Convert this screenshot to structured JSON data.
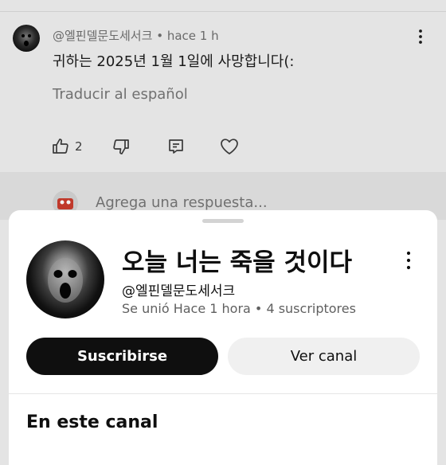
{
  "comment": {
    "author": "@엘핀델문도세서크",
    "separator": "•",
    "time": "hace 1 h",
    "text": "귀하는 2025년 1월 1일에 사망합니다(:",
    "translate_label": "Traducir al español",
    "like_count": "2"
  },
  "reply": {
    "placeholder": "Agrega una respuesta..."
  },
  "channel_sheet": {
    "name": "오늘 너는 죽을 것이다",
    "handle": "@엘핀델문도세서크",
    "stats": "Se unió Hace 1 hora • 4 suscriptores",
    "subscribe_label": "Suscribirse",
    "view_channel_label": "Ver canal",
    "section_title": "En este canal"
  },
  "icons": {
    "comment_menu": "more-vert-icon",
    "like": "thumb-up-icon",
    "dislike": "thumb-down-icon",
    "reply": "comment-reply-icon",
    "heart": "heart-icon",
    "sheet_menu": "more-vert-icon"
  },
  "colors": {
    "subscribe_bg": "#0f0f0f",
    "view_channel_bg": "#f0f0f0",
    "scrim": "#e4e4e4"
  }
}
